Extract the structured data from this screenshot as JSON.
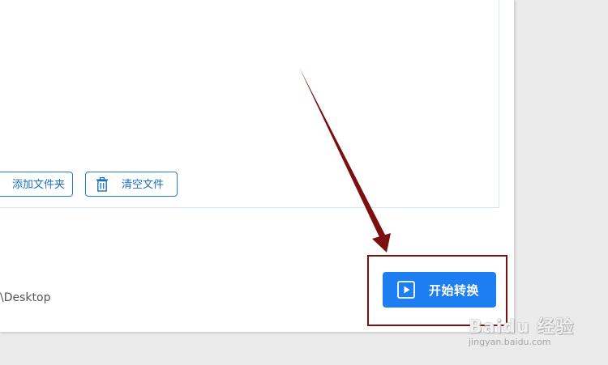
{
  "toolbar": {
    "add_folder_label": "添加文件夹",
    "clear_files_label": "清空文件"
  },
  "output": {
    "path_fragment": "\\Desktop"
  },
  "actions": {
    "start_convert_label": "开始转换"
  },
  "watermark": {
    "main": "Baidu 经验",
    "sub": "jingyan.baidu.com"
  },
  "colors": {
    "primary": "#1c7ef0",
    "outline_button": "#1f7dd8",
    "annotation": "#7a1010",
    "background": "#ebebeb"
  }
}
